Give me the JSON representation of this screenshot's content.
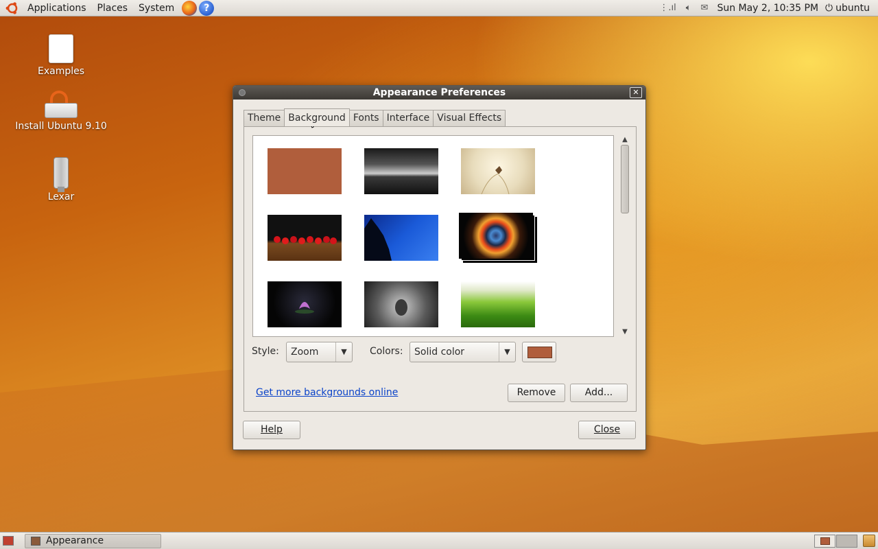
{
  "top_panel": {
    "menus": [
      "Applications",
      "Places",
      "System"
    ],
    "clock": "Sun May  2, 10:35 PM",
    "user": "ubuntu"
  },
  "desktop": {
    "icons": [
      {
        "label": "Examples"
      },
      {
        "label": "Install Ubuntu 9.10"
      },
      {
        "label": "Lexar"
      }
    ]
  },
  "dialog": {
    "title": "Appearance Preferences",
    "tabs": [
      "Theme",
      "Background",
      "Fonts",
      "Interface",
      "Visual Effects"
    ],
    "active_tab": "Background",
    "style_label": "Style:",
    "style_value": "Zoom",
    "colors_label": "Colors:",
    "colors_value": "Solid color",
    "color_swatch": "#b05e3c",
    "link": "Get more backgrounds online",
    "remove_button": "Remove",
    "add_button": "Add...",
    "help_button": "Help",
    "close_button": "Close"
  },
  "taskbar": {
    "window_button": "Appearance Preferences"
  },
  "colors": {
    "accent": "#e8641a",
    "link": "#0b43c9"
  }
}
